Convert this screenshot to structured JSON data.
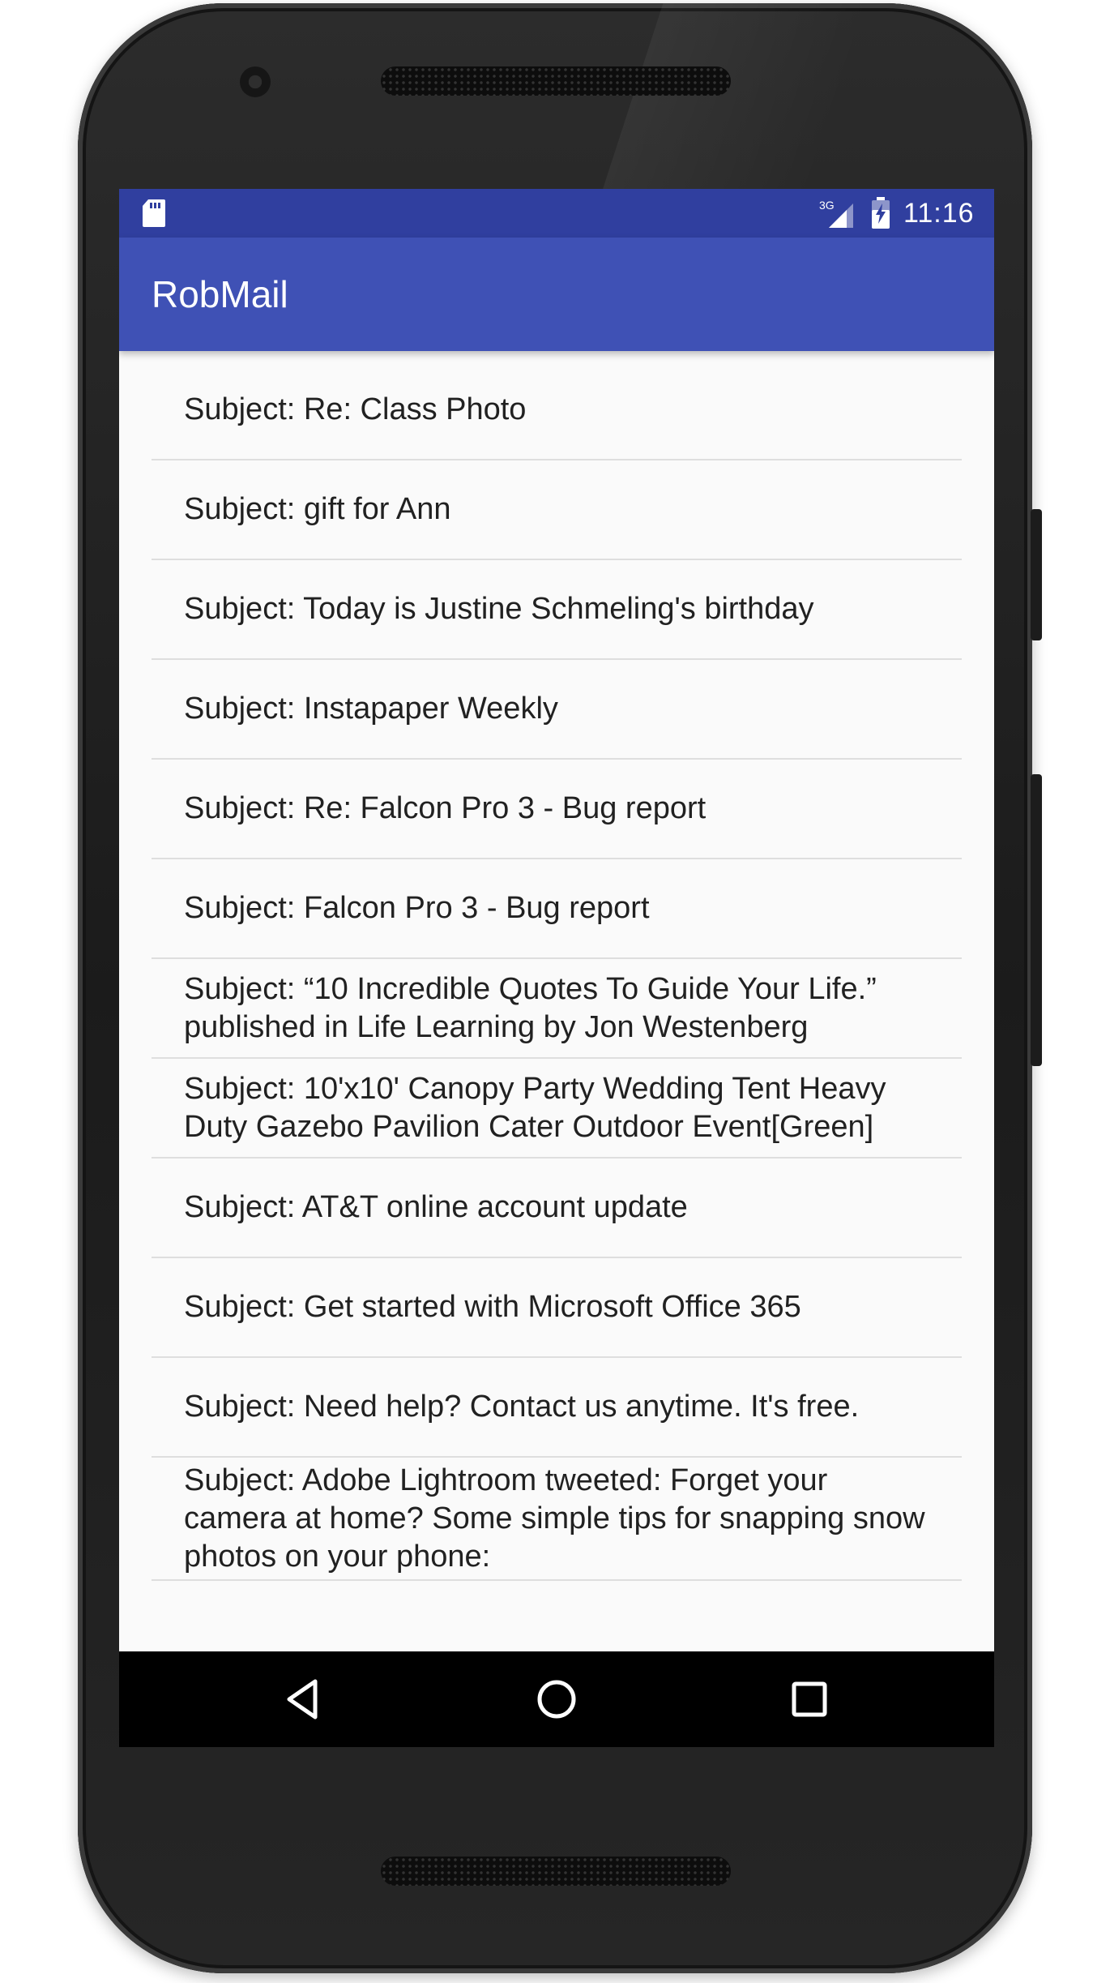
{
  "status_bar": {
    "time": "11:16",
    "network_label": "3G",
    "icons": [
      "sd-card-icon",
      "cellular-signal-icon",
      "battery-charging-icon"
    ]
  },
  "app_bar": {
    "title": "RobMail"
  },
  "mail_list": {
    "items": [
      {
        "subject": "Subject: Re: Class Photo"
      },
      {
        "subject": "Subject: gift for Ann"
      },
      {
        "subject": "Subject: Today is Justine Schmeling's birthday"
      },
      {
        "subject": "Subject: Instapaper Weekly"
      },
      {
        "subject": "Subject: Re: Falcon Pro 3 - Bug report"
      },
      {
        "subject": "Subject: Falcon Pro 3 - Bug report"
      },
      {
        "subject": "Subject: “10 Incredible Quotes To Guide Your Life.” published in Life Learning by Jon Westenberg"
      },
      {
        "subject": "Subject: 10'x10' Canopy Party Wedding Tent Heavy Duty Gazebo Pavilion Cater Outdoor Event[Green]"
      },
      {
        "subject": "Subject: AT&T online account update"
      },
      {
        "subject": "Subject: Get started with Microsoft Office 365"
      },
      {
        "subject": "Subject: Need help? Contact us anytime. It's free."
      },
      {
        "subject": "Subject: Adobe Lightroom tweeted: Forget your camera at home? Some simple tips for snapping snow photos on your phone:"
      }
    ]
  },
  "nav_bar": {
    "icons": [
      "back-icon",
      "home-icon",
      "recents-icon"
    ]
  },
  "colors": {
    "status_bar": "#303f9f",
    "app_bar": "#3f51b5",
    "list_background": "#fafafa",
    "divider": "#dedede",
    "text": "#212121",
    "nav_bar": "#000000"
  }
}
